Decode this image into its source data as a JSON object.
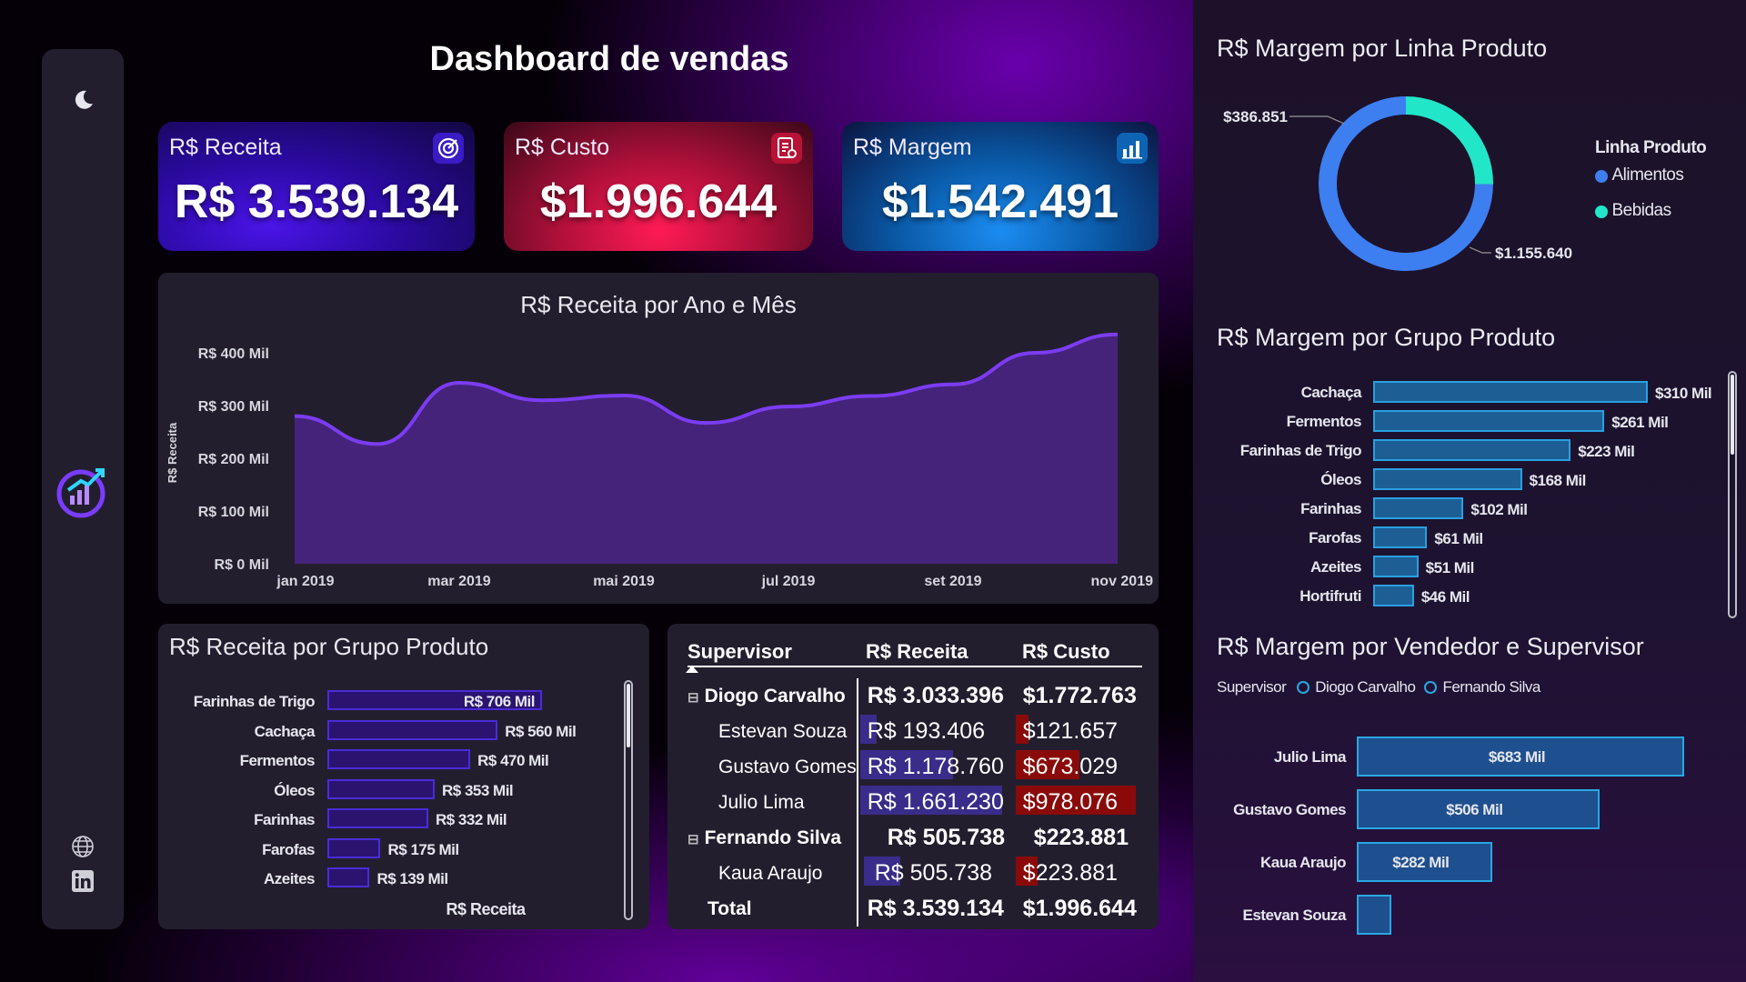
{
  "dashboard_title": "Dashboard de vendas",
  "sidebar": {
    "icons": [
      "moon-icon",
      "growth-chart-logo-icon",
      "globe-icon",
      "linkedin-icon"
    ]
  },
  "kpis": [
    {
      "label": "R$ Receita",
      "value": "R$ 3.539.134",
      "icon": "target-icon",
      "color": "#3b1ad1"
    },
    {
      "label": "R$ Custo",
      "value": "$1.996.644",
      "icon": "invoice-icon",
      "color": "#c4113f"
    },
    {
      "label": "R$ Margem",
      "value": "$1.542.491",
      "icon": "bar-chart-icon",
      "color": "#0a6fd0"
    }
  ],
  "line_chart": {
    "title": "R$ Receita por Ano e Mês",
    "ylabel": "R$ Receita",
    "yticks": [
      "R$ 400 Mil",
      "R$ 300 Mil",
      "R$ 200 Mil",
      "R$ 100 Mil",
      "R$ 0 Mil"
    ],
    "xticks": [
      "jan 2019",
      "mar 2019",
      "mai 2019",
      "jul 2019",
      "set 2019",
      "nov 2019"
    ]
  },
  "bar_receita": {
    "title": "R$ Receita por Grupo Produto",
    "footer": "R$ Receita",
    "rows": [
      {
        "label": "Farinhas de Trigo",
        "text": "R$ 706 Mil"
      },
      {
        "label": "Cachaça",
        "text": "R$ 560 Mil"
      },
      {
        "label": "Fermentos",
        "text": "R$ 470 Mil"
      },
      {
        "label": "Óleos",
        "text": "R$ 353 Mil"
      },
      {
        "label": "Farinhas",
        "text": "R$ 332 Mil"
      },
      {
        "label": "Farofas",
        "text": "R$ 175 Mil"
      },
      {
        "label": "Azeites",
        "text": "R$ 139 Mil"
      }
    ]
  },
  "table": {
    "headers": [
      "Supervisor",
      "R$ Receita",
      "R$ Custo"
    ],
    "rows": [
      {
        "name": "Diogo Carvalho",
        "receita": "R$ 3.033.396",
        "custo": "$1.772.763"
      },
      {
        "name": "Estevan Souza",
        "receita": "R$ 193.406",
        "custo": "$121.657"
      },
      {
        "name": "Gustavo Gomes",
        "receita": "R$ 1.178.760",
        "custo": "$673.029"
      },
      {
        "name": "Julio Lima",
        "receita": "R$ 1.661.230",
        "custo": "$978.076"
      },
      {
        "name": "Fernando Silva",
        "receita": "R$ 505.738",
        "custo": "$223.881"
      },
      {
        "name": "Kaua Araujo",
        "receita": "R$ 505.738",
        "custo": "$223.881"
      },
      {
        "name": "Total",
        "receita": "R$ 3.539.134",
        "custo": "$1.996.644"
      }
    ]
  },
  "donut": {
    "title": "R$ Margem por Linha Produto",
    "legend_title": "Linha Produto",
    "bebidas_label": "$386.851",
    "alimentos_label": "$1.155.640",
    "legend": [
      {
        "name": "Alimentos",
        "color": "#3d7ef0"
      },
      {
        "name": "Bebidas",
        "color": "#22e6c8"
      }
    ]
  },
  "margem_grupo": {
    "title": "R$ Margem por Grupo Produto",
    "rows": [
      {
        "label": "Cachaça",
        "text": "$310 Mil"
      },
      {
        "label": "Fermentos",
        "text": "$261 Mil"
      },
      {
        "label": "Farinhas de Trigo",
        "text": "$223 Mil"
      },
      {
        "label": "Óleos",
        "text": "$168 Mil"
      },
      {
        "label": "Farinhas",
        "text": "$102 Mil"
      },
      {
        "label": "Farofas",
        "text": "$61 Mil"
      },
      {
        "label": "Azeites",
        "text": "$51 Mil"
      },
      {
        "label": "Hortifruti",
        "text": "$46 Mil"
      }
    ]
  },
  "margem_vendedor": {
    "title": "R$ Margem por Vendedor e Supervisor",
    "legend_title": "Supervisor",
    "legend": [
      {
        "name": "Diogo Carvalho",
        "color": "#29a8e0"
      },
      {
        "name": "Fernando Silva",
        "color": "#29a8e0"
      }
    ],
    "rows": [
      {
        "label": "Julio Lima",
        "text": "$683 Mil"
      },
      {
        "label": "Gustavo Gomes",
        "text": "$506 Mil"
      },
      {
        "label": "Kaua Araujo",
        "text": "$282 Mil"
      },
      {
        "label": "Estevan Souza",
        "text": ""
      }
    ]
  },
  "chart_data": [
    {
      "type": "area",
      "title": "R$ Receita por Ano e Mês",
      "ylabel": "R$ Receita",
      "x": [
        "jan 2019",
        "fev 2019",
        "mar 2019",
        "abr 2019",
        "mai 2019",
        "jun 2019",
        "jul 2019",
        "ago 2019",
        "set 2019",
        "out 2019",
        "nov 2019"
      ],
      "values": [
        280,
        227,
        343,
        310,
        319,
        267,
        298,
        318,
        340,
        400,
        435
      ],
      "ylim": [
        0,
        400
      ],
      "yticks": [
        0,
        100,
        200,
        300,
        400
      ],
      "color": "#6a2fe6"
    },
    {
      "type": "bar",
      "title": "R$ Receita por Grupo Produto",
      "xlabel": "R$ Receita",
      "categories": [
        "Farinhas de Trigo",
        "Cachaça",
        "Fermentos",
        "Óleos",
        "Farinhas",
        "Farofas",
        "Azeites"
      ],
      "values": [
        706,
        560,
        470,
        353,
        332,
        175,
        139
      ],
      "color": "#3b1ad1"
    },
    {
      "type": "pie",
      "title": "R$ Margem por Linha Produto",
      "categories": [
        "Alimentos",
        "Bebidas"
      ],
      "values": [
        1155640,
        386851
      ]
    },
    {
      "type": "bar",
      "title": "R$ Margem por Grupo Produto",
      "categories": [
        "Cachaça",
        "Fermentos",
        "Farinhas de Trigo",
        "Óleos",
        "Farinhas",
        "Farofas",
        "Azeites",
        "Hortifruti"
      ],
      "values": [
        310,
        261,
        223,
        168,
        102,
        61,
        51,
        46
      ],
      "color": "#1f6fb0"
    },
    {
      "type": "bar",
      "title": "R$ Margem por Vendedor e Supervisor",
      "categories": [
        "Julio Lima",
        "Gustavo Gomes",
        "Kaua Araujo",
        "Estevan Souza"
      ],
      "values": [
        683,
        506,
        282,
        72
      ],
      "color": "#1e4f8e"
    }
  ]
}
